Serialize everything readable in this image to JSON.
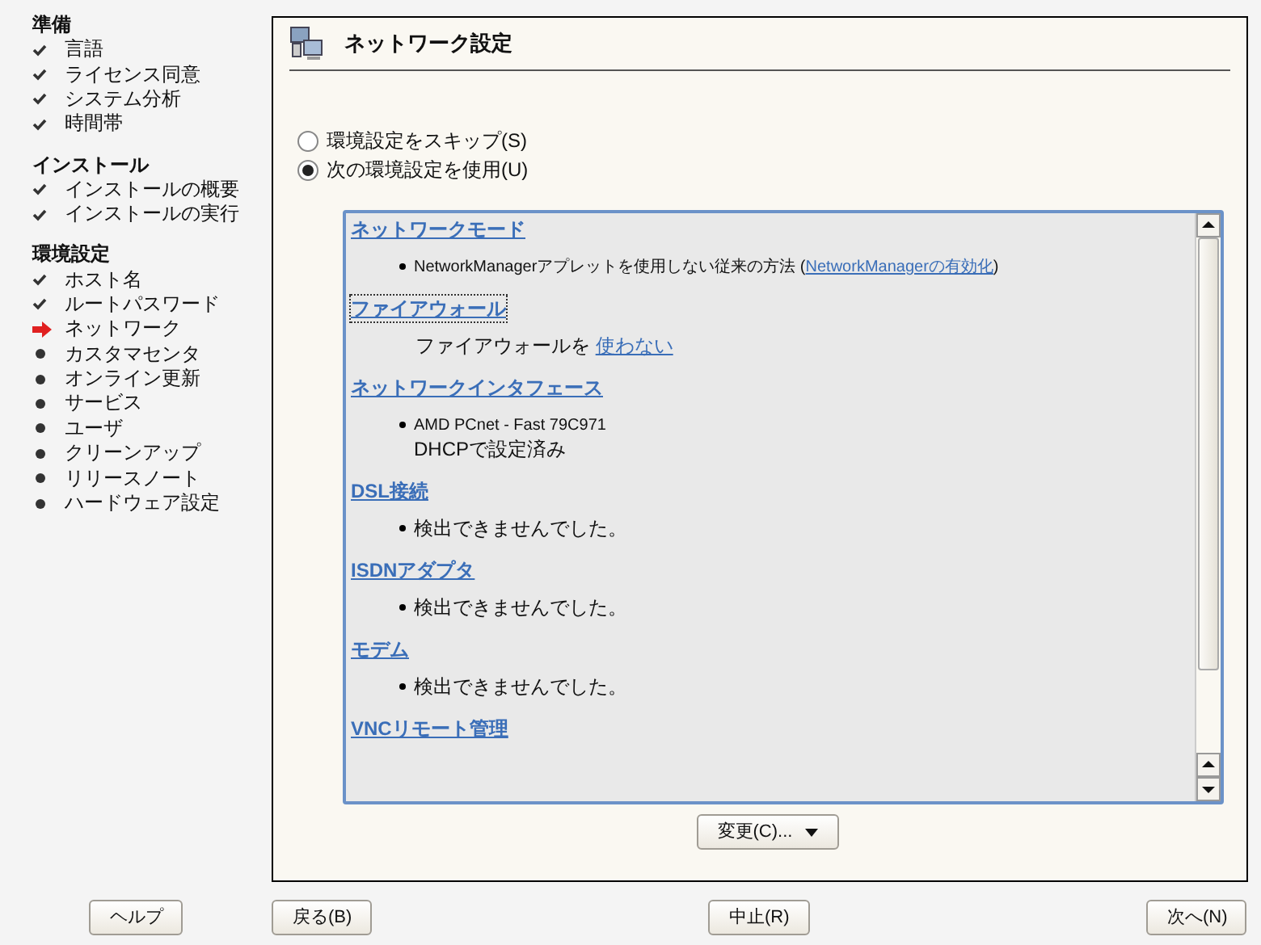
{
  "sidebar": {
    "groups": [
      {
        "title": "準備",
        "items": [
          {
            "label": "言語",
            "kind": "done"
          },
          {
            "label": "ライセンス同意",
            "kind": "done"
          },
          {
            "label": "システム分析",
            "kind": "done"
          },
          {
            "label": "時間帯",
            "kind": "done"
          }
        ]
      },
      {
        "title": "インストール",
        "items": [
          {
            "label": "インストールの概要",
            "kind": "done"
          },
          {
            "label": "インストールの実行",
            "kind": "done"
          }
        ]
      },
      {
        "title": "環境設定",
        "items": [
          {
            "label": "ホスト名",
            "kind": "done"
          },
          {
            "label": "ルートパスワード",
            "kind": "done"
          },
          {
            "label": "ネットワーク",
            "kind": "current"
          },
          {
            "label": "カスタマセンタ",
            "kind": "pending"
          },
          {
            "label": "オンライン更新",
            "kind": "pending"
          },
          {
            "label": "サービス",
            "kind": "pending"
          },
          {
            "label": "ユーザ",
            "kind": "pending"
          },
          {
            "label": "クリーンアップ",
            "kind": "pending"
          },
          {
            "label": "リリースノート",
            "kind": "pending"
          },
          {
            "label": "ハードウェア設定",
            "kind": "pending"
          }
        ]
      }
    ]
  },
  "panel": {
    "title": "ネットワーク設定",
    "options": [
      {
        "label": "環境設定をスキップ(S)",
        "selected": false
      },
      {
        "label": "次の環境設定を使用(U)",
        "selected": true
      }
    ],
    "sections": [
      {
        "title": "ネットワークモード",
        "focused": false,
        "items": [
          {
            "kind": "bullet",
            "text": "NetworkManagerアプレットを使用しない従来の方法 (",
            "link": "NetworkManagerの有効化",
            "suffix": ")"
          }
        ]
      },
      {
        "title": "ファイアウォール",
        "focused": true,
        "items": [
          {
            "kind": "plain",
            "text": "ファイアウォールを ",
            "link": "使わない"
          }
        ]
      },
      {
        "title": "ネットワークインタフェース",
        "focused": false,
        "items": [
          {
            "kind": "bullet",
            "lines": [
              "AMD PCnet - Fast 79C971",
              "DHCPで設定済み"
            ]
          }
        ]
      },
      {
        "title": "DSL接続",
        "focused": false,
        "items": [
          {
            "kind": "bullet",
            "text": "検出できませんでした。"
          }
        ]
      },
      {
        "title": "ISDNアダプタ",
        "focused": false,
        "items": [
          {
            "kind": "bullet",
            "text": "検出できませんでした。"
          }
        ]
      },
      {
        "title": "モデム",
        "focused": false,
        "items": [
          {
            "kind": "bullet",
            "text": "検出できませんでした。"
          }
        ]
      },
      {
        "title": "VNCリモート管理",
        "focused": false
      }
    ],
    "change_button": "変更(C)..."
  },
  "footer": {
    "help": "ヘルプ",
    "back": "戻る(B)",
    "abort": "中止(R)",
    "next": "次へ(N)"
  }
}
